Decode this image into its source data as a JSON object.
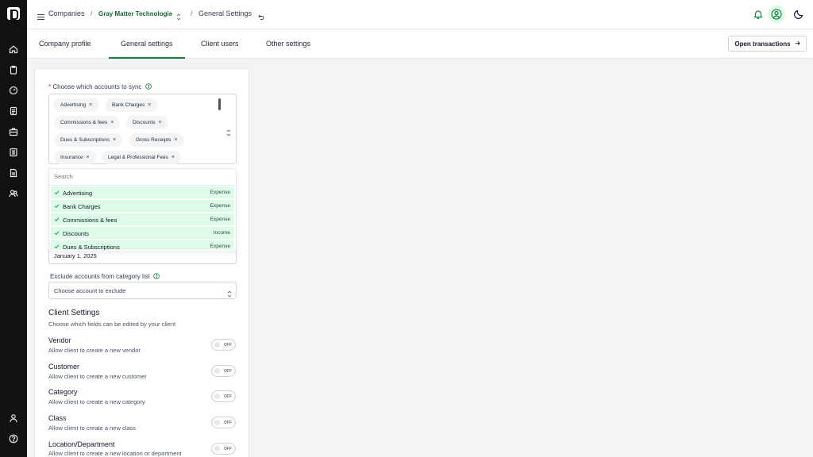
{
  "breadcrumb": {
    "root": "Companies",
    "sep": "/",
    "company": "Gray Matter Technologie",
    "page": "General Settings"
  },
  "tabs": [
    {
      "label": "Company profile",
      "active": false
    },
    {
      "label": "General settings",
      "active": true
    },
    {
      "label": "Client users",
      "active": false
    },
    {
      "label": "Other settings",
      "active": false
    }
  ],
  "open_transactions_label": "Open transactions",
  "accounts_sync": {
    "required_mark": "*",
    "label": "Choose which accounts to sync",
    "tags": [
      "Advertising",
      "Bank Charges",
      "Commissions & fees",
      "Discounts",
      "Dues & Subscriptions",
      "Gross Receipts",
      "Insurance",
      "Legal & Professional Fees"
    ],
    "search_placeholder": "Search",
    "options": [
      {
        "name": "Advertising",
        "type": "Expense"
      },
      {
        "name": "Bank Charges",
        "type": "Expense"
      },
      {
        "name": "Commissions & fees",
        "type": "Expense"
      },
      {
        "name": "Discounts",
        "type": "Income"
      },
      {
        "name": "Dues & Subscriptions",
        "type": "Expense"
      }
    ]
  },
  "start_date": "January 1, 2025",
  "exclude": {
    "label": "Exclude accounts from category list",
    "placeholder": "Choose account to exclude"
  },
  "client_settings": {
    "title": "Client Settings",
    "subtitle": "Choose which fields can be edited by your client",
    "toggle_off_text": "OFF",
    "items": [
      {
        "name": "Vendor",
        "desc": "Allow client to create a new vendor"
      },
      {
        "name": "Customer",
        "desc": "Allow client to create a new customer"
      },
      {
        "name": "Category",
        "desc": "Allow client to create a new category"
      },
      {
        "name": "Class",
        "desc": "Allow client to create a new class"
      },
      {
        "name": "Location/Department",
        "desc": "Allow client to create a new location or department"
      }
    ]
  },
  "colors": {
    "brand_green": "#15803d",
    "selected_row": "#dcfce7",
    "rail": "#111111"
  }
}
